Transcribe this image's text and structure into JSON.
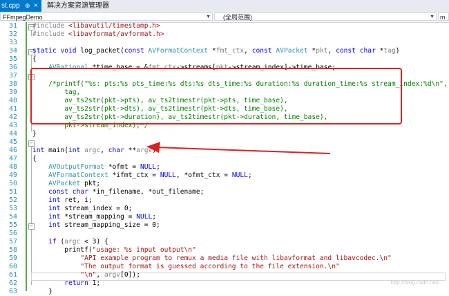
{
  "tabs": {
    "active_label": "st.cpp",
    "active_pin": "⊕",
    "active_close": "×",
    "other_label": "解决方案资源管理器"
  },
  "nav": {
    "project": "FFmpegDemo",
    "scope": "(全局范围)",
    "member": "m"
  },
  "colors": {
    "keyword": "#0000ff",
    "type": "#2b91af",
    "string": "#a31515",
    "comment": "#008000",
    "annotation": "#e02020"
  },
  "editor": {
    "line_numbers": [
      "31",
      "32",
      "33",
      "34",
      "35",
      "36",
      "37",
      "38",
      "39",
      "40",
      "41",
      "42",
      "43",
      "44",
      "45",
      "46",
      "47",
      "48",
      "49",
      "50",
      "51",
      "52",
      "53",
      "54",
      "55",
      "56",
      "57",
      "58",
      "59",
      "60",
      "61",
      "62",
      "63"
    ],
    "lines": {
      "l31a": "#include ",
      "l31b": "<libavutil/timestamp.h>",
      "l32a": "#include ",
      "l32b": "<libavformat/avformat.h>",
      "l34a": "static",
      "l34b": " ",
      "l34c": "void",
      "l34d": " log_packet(",
      "l34e": "const",
      "l34f": " ",
      "l34g": "AVFormatContext",
      "l34h": " *",
      "l34i": "fmt_ctx",
      "l34j": ", ",
      "l34k": "const",
      "l34l": " ",
      "l34m": "AVPacket",
      "l34n": " *",
      "l34o": "pkt",
      "l34p": ", ",
      "l34q": "const",
      "l34r": " ",
      "l34s": "char",
      "l34t": " *",
      "l34u": "tag",
      "l34v": ")",
      "l35": "{",
      "l36a": "    ",
      "l36b": "AVRational",
      "l36c": " *time_base = &",
      "l36d": "fmt_ctx",
      "l36e": "->streams[",
      "l36f": "pkt",
      "l36g": "->stream_index]->time_base;",
      "l38": "    /*printf(\"%s: pts:%s pts_time:%s dts:%s dts_time:%s duration:%s duration_time:%s stream_index:%d\\n\",",
      "l39": "        tag,",
      "l40": "        av_ts2str(pkt->pts), av_ts2timestr(pkt->pts, time_base),",
      "l41": "        av_ts2str(pkt->dts), av_ts2timestr(pkt->dts, time_base),",
      "l42": "        av_ts2str(pkt->duration), av_ts2timestr(pkt->duration, time_base),",
      "l43": "        pkt->stream_index);*/",
      "l44": "}",
      "l46a": "int",
      "l46b": " main(",
      "l46c": "int",
      "l46d": " ",
      "l46e": "argc",
      "l46f": ", ",
      "l46g": "char",
      "l46h": " **",
      "l46i": "argv",
      "l46j": ")",
      "l47": "{",
      "l48a": "    ",
      "l48b": "AVOutputFormat",
      "l48c": " *ofmt = ",
      "l48d": "NULL",
      "l48e": ";",
      "l49a": "    ",
      "l49b": "AVFormatContext",
      "l49c": " *ifmt_ctx = ",
      "l49d": "NULL",
      "l49e": ", *ofmt_ctx = ",
      "l49f": "NULL",
      "l49g": ";",
      "l50a": "    ",
      "l50b": "AVPacket",
      "l50c": " pkt;",
      "l51a": "    ",
      "l51b": "const",
      "l51c": " ",
      "l51d": "char",
      "l51e": " *in_filename, *out_filename;",
      "l52a": "    ",
      "l52b": "int",
      "l52c": " ret, i;",
      "l53a": "    ",
      "l53b": "int",
      "l53c": " stream_index = 0;",
      "l54a": "    ",
      "l54b": "int",
      "l54c": " *stream_mapping = ",
      "l54d": "NULL",
      "l54e": ";",
      "l55a": "    ",
      "l55b": "int",
      "l55c": " stream_mapping_size = 0;",
      "l57a": "    ",
      "l57b": "if",
      "l57c": " (",
      "l57d": "argc",
      "l57e": " < 3) {",
      "l58a": "        printf(",
      "l58b": "\"usage: %s input output\\n\"",
      "l59a": "            ",
      "l59b": "\"API example program to remux a media file with libavformat and libavcodec.\\n\"",
      "l60a": "            ",
      "l60b": "\"The output format is guessed according to the file extension.\\n\"",
      "l61a": "            ",
      "l61b": "\"\\n\"",
      "l61c": ", ",
      "l61d": "argv",
      "l61e": "[0]);",
      "l62a": "        ",
      "l62b": "return",
      "l62c": " 1;",
      "l63": "    }"
    }
  },
  "watermark": "http://blog.csdn.net/..."
}
